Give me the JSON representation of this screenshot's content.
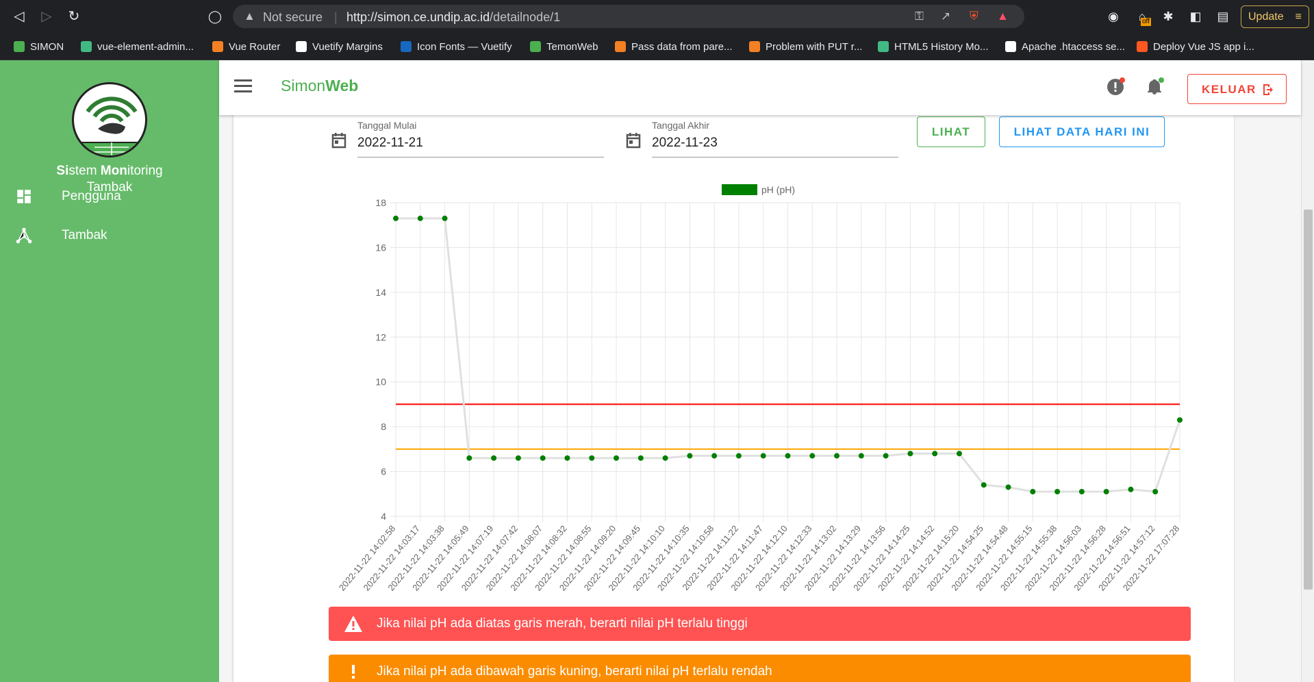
{
  "browser": {
    "security": "Not secure",
    "url_host": "http://simon.ce.undip.ac.id",
    "url_path": "/detailnode/1",
    "update_label": "Update",
    "ext_badge": "off",
    "bookmarks": [
      {
        "label": "SIMON",
        "icon": "leaf-icon",
        "color": "#4caf50"
      },
      {
        "label": "vue-element-admin...",
        "icon": "vue-admin-icon",
        "color": "#42b983"
      },
      {
        "label": "Vue Router",
        "icon": "stackoverflow-icon",
        "color": "#f48024"
      },
      {
        "label": "Vuetify Margins",
        "icon": "medium-icon",
        "color": "#ffffff"
      },
      {
        "label": "Icon Fonts — Vuetify",
        "icon": "vuetify-icon",
        "color": "#1867c0"
      },
      {
        "label": "TemonWeb",
        "icon": "temon-icon",
        "color": "#4caf50"
      },
      {
        "label": "Pass data from pare...",
        "icon": "stackoverflow-icon",
        "color": "#f48024"
      },
      {
        "label": "Problem with PUT r...",
        "icon": "stackoverflow-icon",
        "color": "#f48024"
      },
      {
        "label": "HTML5 History Mo...",
        "icon": "vue-icon",
        "color": "#42b983"
      },
      {
        "label": "Apache .htaccess se...",
        "icon": "github-icon",
        "color": "#ffffff"
      },
      {
        "label": "Deploy Vue JS app i...",
        "icon": "blogger-icon",
        "color": "#ff5722"
      }
    ]
  },
  "sidebar": {
    "brand_line1_parts": [
      "Si",
      "stem ",
      "Mon",
      "itoring"
    ],
    "brand_line2": "Tambak",
    "items": [
      {
        "label": "Pengguna",
        "icon": "dashboard-icon"
      },
      {
        "label": "Tambak",
        "icon": "network-icon"
      }
    ]
  },
  "appbar": {
    "title_light": "Simon",
    "title_bold": "Web",
    "logout_label": "KELUAR"
  },
  "filters": {
    "start_label": "Tanggal Mulai",
    "start_value": "2022-11-21",
    "end_label": "Tanggal Akhir",
    "end_value": "2022-11-23",
    "view_button": "LIHAT",
    "today_button": "LIHAT DATA HARI INI"
  },
  "chart_data": {
    "type": "line",
    "legend": "pH (pH)",
    "legend_position": "top",
    "series_color": "#008000",
    "line_color": "#e0e0e0",
    "grid": true,
    "ylim": [
      4,
      18
    ],
    "yticks": [
      4,
      6,
      8,
      10,
      12,
      14,
      16,
      18
    ],
    "thresholds": [
      {
        "value": 9,
        "color": "#ff0000"
      },
      {
        "value": 7,
        "color": "#ffa500"
      }
    ],
    "categories": [
      "2022-11-22 14:02:58",
      "2022-11-22 14:03:17",
      "2022-11-22 14:03:38",
      "2022-11-22 14:05:49",
      "2022-11-22 14:07:19",
      "2022-11-22 14:07:42",
      "2022-11-22 14:08:07",
      "2022-11-22 14:08:32",
      "2022-11-22 14:08:55",
      "2022-11-22 14:09:20",
      "2022-11-22 14:09:45",
      "2022-11-22 14:10:10",
      "2022-11-22 14:10:35",
      "2022-11-22 14:10:58",
      "2022-11-22 14:11:22",
      "2022-11-22 14:11:47",
      "2022-11-22 14:12:10",
      "2022-11-22 14:12:33",
      "2022-11-22 14:13:02",
      "2022-11-22 14:13:29",
      "2022-11-22 14:13:56",
      "2022-11-22 14:14:25",
      "2022-11-22 14:14:52",
      "2022-11-22 14:15:20",
      "2022-11-22 14:54:25",
      "2022-11-22 14:54:48",
      "2022-11-22 14:55:15",
      "2022-11-22 14:55:38",
      "2022-11-22 14:56:03",
      "2022-11-22 14:56:28",
      "2022-11-22 14:56:51",
      "2022-11-22 14:57:12",
      "2022-11-22 17:07:28"
    ],
    "values": [
      17.3,
      17.3,
      17.3,
      6.6,
      6.6,
      6.6,
      6.6,
      6.6,
      6.6,
      6.6,
      6.6,
      6.6,
      6.7,
      6.7,
      6.7,
      6.7,
      6.7,
      6.7,
      6.7,
      6.7,
      6.7,
      6.8,
      6.8,
      6.8,
      5.4,
      5.3,
      5.1,
      5.1,
      5.1,
      5.1,
      5.2,
      5.1,
      8.3
    ]
  },
  "alerts": [
    {
      "text": "Jika nilai pH ada diatas garis merah, berarti nilai pH terlalu tinggi",
      "color": "#ff5252",
      "icon": "warning-icon"
    },
    {
      "text": "Jika nilai pH ada dibawah garis kuning, berarti nilai pH terlalu rendah",
      "color": "#fb8c00",
      "icon": "exclamation-icon"
    }
  ]
}
